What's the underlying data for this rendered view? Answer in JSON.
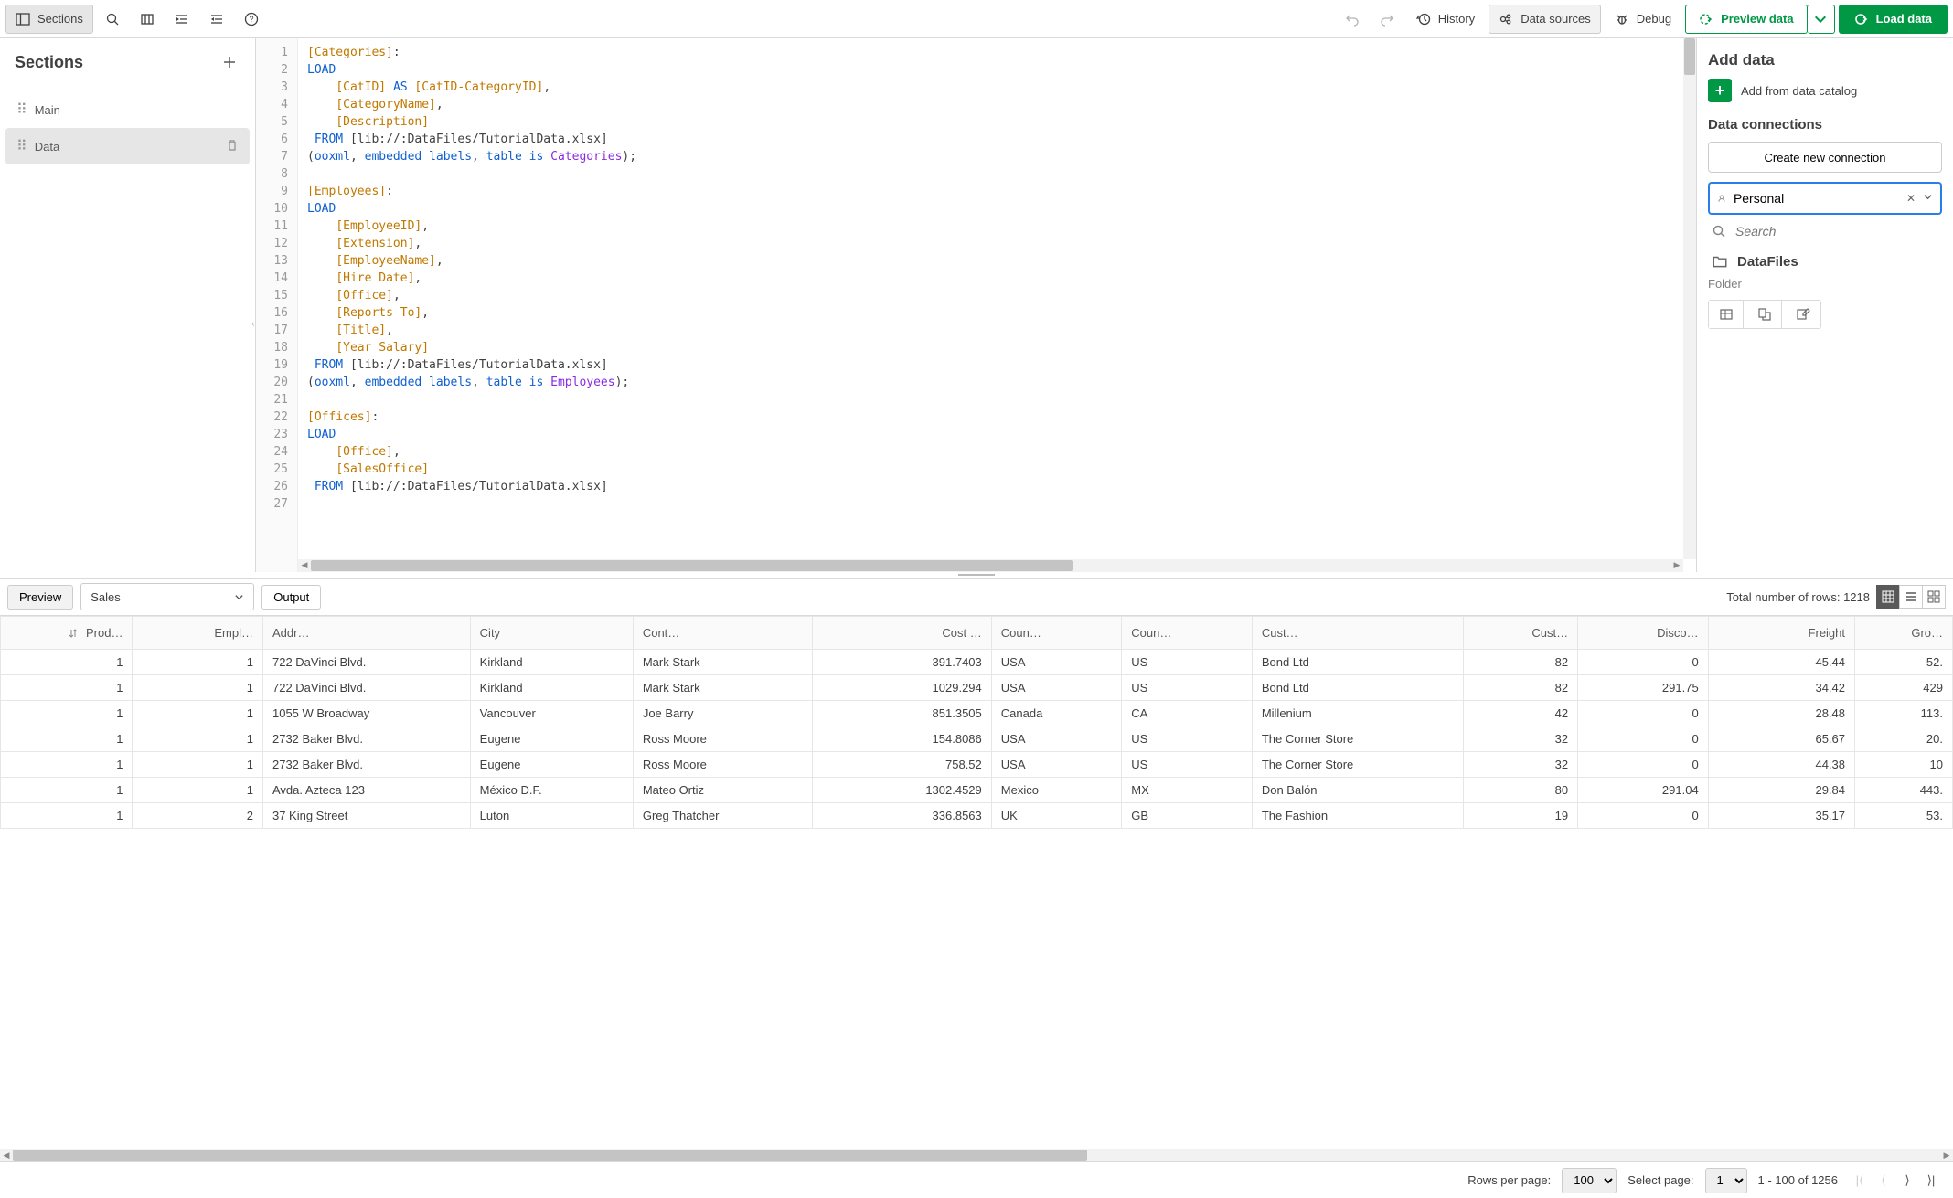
{
  "toolbar": {
    "sections_label": "Sections",
    "history_label": "History",
    "data_sources_label": "Data sources",
    "debug_label": "Debug",
    "preview_label": "Preview data",
    "load_label": "Load data"
  },
  "sidebar": {
    "title": "Sections",
    "items": [
      {
        "label": "Main"
      },
      {
        "label": "Data"
      }
    ],
    "active_index": 1
  },
  "editor": {
    "lines": [
      {
        "n": 1,
        "html": "<span class='tok-field'>[Categories]</span>:"
      },
      {
        "n": 2,
        "html": "<span class='tok-kw'>LOAD</span>"
      },
      {
        "n": 3,
        "html": "    <span class='tok-field'>[CatID]</span> <span class='tok-kw'>AS</span> <span class='tok-field'>[CatID-CategoryID]</span>,"
      },
      {
        "n": 4,
        "html": "    <span class='tok-field'>[CategoryName]</span>,"
      },
      {
        "n": 5,
        "html": "    <span class='tok-field'>[Description]</span>"
      },
      {
        "n": 6,
        "html": " <span class='tok-kw'>FROM</span> [lib://:DataFiles/TutorialData.xlsx]"
      },
      {
        "n": 7,
        "html": "(<span class='tok-blue'>ooxml</span>, <span class='tok-blue'>embedded labels</span>, <span class='tok-blue'>table is</span> <span class='tok-purple'>Categories</span>);"
      },
      {
        "n": 8,
        "html": " "
      },
      {
        "n": 9,
        "html": "<span class='tok-field'>[Employees]</span>:"
      },
      {
        "n": 10,
        "html": "<span class='tok-kw'>LOAD</span>"
      },
      {
        "n": 11,
        "html": "    <span class='tok-field'>[EmployeeID]</span>,"
      },
      {
        "n": 12,
        "html": "    <span class='tok-field'>[Extension]</span>,"
      },
      {
        "n": 13,
        "html": "    <span class='tok-field'>[EmployeeName]</span>,"
      },
      {
        "n": 14,
        "html": "    <span class='tok-field'>[Hire Date]</span>,"
      },
      {
        "n": 15,
        "html": "    <span class='tok-field'>[Office]</span>,"
      },
      {
        "n": 16,
        "html": "    <span class='tok-field'>[Reports To]</span>,"
      },
      {
        "n": 17,
        "html": "    <span class='tok-field'>[Title]</span>,"
      },
      {
        "n": 18,
        "html": "    <span class='tok-field'>[Year Salary]</span>"
      },
      {
        "n": 19,
        "html": " <span class='tok-kw'>FROM</span> [lib://:DataFiles/TutorialData.xlsx]"
      },
      {
        "n": 20,
        "html": "(<span class='tok-blue'>ooxml</span>, <span class='tok-blue'>embedded labels</span>, <span class='tok-blue'>table is</span> <span class='tok-purple'>Employees</span>);"
      },
      {
        "n": 21,
        "html": " "
      },
      {
        "n": 22,
        "html": "<span class='tok-field'>[Offices]</span>:"
      },
      {
        "n": 23,
        "html": "<span class='tok-kw'>LOAD</span>"
      },
      {
        "n": 24,
        "html": "    <span class='tok-field'>[Office]</span>,"
      },
      {
        "n": 25,
        "html": "    <span class='tok-field'>[SalesOffice]</span>"
      },
      {
        "n": 26,
        "html": " <span class='tok-kw'>FROM</span> [lib://:DataFiles/TutorialData.xlsx]"
      },
      {
        "n": 27,
        "html": " "
      }
    ]
  },
  "right_panel": {
    "add_data_title": "Add data",
    "add_catalog_label": "Add from data catalog",
    "connections_title": "Data connections",
    "create_connection_label": "Create new connection",
    "space_value": "Personal",
    "search_placeholder": "Search",
    "folder": {
      "name": "DataFiles",
      "type": "Folder"
    }
  },
  "preview": {
    "preview_tab": "Preview",
    "output_tab": "Output",
    "table_select": "Sales",
    "total_rows_label": "Total number of rows: 1218",
    "columns": [
      "Prod…",
      "Empl…",
      "Addr…",
      "City",
      "Cont…",
      "Cost …",
      "Coun…",
      "Coun…",
      "Cust…",
      "Cust…",
      "Disco…",
      "Freight",
      "Gro…"
    ],
    "numeric_cols": [
      0,
      1,
      5,
      9,
      10,
      11,
      12
    ],
    "rows": [
      [
        "1",
        "1",
        "722 DaVinci Blvd.",
        "Kirkland",
        "Mark Stark",
        "391.7403",
        "USA",
        "US",
        "Bond Ltd",
        "82",
        "0",
        "45.44",
        "52."
      ],
      [
        "1",
        "1",
        "722 DaVinci Blvd.",
        "Kirkland",
        "Mark Stark",
        "1029.294",
        "USA",
        "US",
        "Bond Ltd",
        "82",
        "291.75",
        "34.42",
        "429"
      ],
      [
        "1",
        "1",
        "1055 W Broadway",
        "Vancouver",
        "Joe Barry",
        "851.3505",
        "Canada",
        "CA",
        "Millenium",
        "42",
        "0",
        "28.48",
        "113."
      ],
      [
        "1",
        "1",
        "2732 Baker Blvd.",
        "Eugene",
        "Ross Moore",
        "154.8086",
        "USA",
        "US",
        "The Corner Store",
        "32",
        "0",
        "65.67",
        "20."
      ],
      [
        "1",
        "1",
        "2732 Baker Blvd.",
        "Eugene",
        "Ross Moore",
        "758.52",
        "USA",
        "US",
        "The Corner Store",
        "32",
        "0",
        "44.38",
        "10"
      ],
      [
        "1",
        "1",
        "Avda. Azteca 123",
        "México D.F.",
        "Mateo Ortiz",
        "1302.4529",
        "Mexico",
        "MX",
        "Don Balón",
        "80",
        "291.04",
        "29.84",
        "443."
      ],
      [
        "1",
        "2",
        "37 King Street",
        "Luton",
        "Greg Thatcher",
        "336.8563",
        "UK",
        "GB",
        "The Fashion",
        "19",
        "0",
        "35.17",
        "53."
      ]
    ]
  },
  "pagination": {
    "rows_per_page_label": "Rows per page:",
    "rows_per_page_value": "100",
    "select_page_label": "Select page:",
    "page_value": "1",
    "range_label": "1 - 100 of 1256"
  }
}
